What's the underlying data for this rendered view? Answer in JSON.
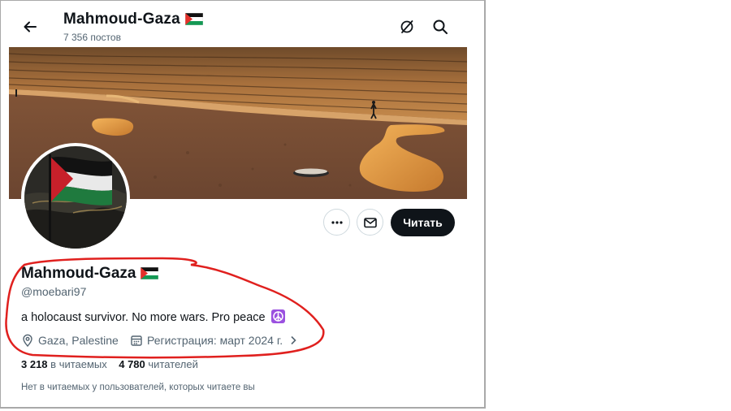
{
  "header": {
    "title": "Mahmoud-Gaza",
    "posts_count": "7 356 постов"
  },
  "profile": {
    "name": "Mahmoud-Gaza",
    "handle": "@moebari97",
    "bio": "a holocaust survivor. No more wars. Pro peace",
    "location": "Gaza, Palestine",
    "joined": "Регистрация: март 2024 г.",
    "following_count": "3 218",
    "following_label": "в читаемых",
    "followers_count": "4 780",
    "followers_label": "читателей",
    "mutuals_note": "Нет в читаемых у пользователей, которых читаете вы"
  },
  "actions": {
    "follow_label": "Читать"
  },
  "icons": [
    "back-arrow-icon",
    "flag-emoji-icon",
    "grok-icon",
    "search-icon",
    "more-icon",
    "mail-icon",
    "peace-icon",
    "location-icon",
    "calendar-icon",
    "chevron-right-icon"
  ],
  "colors": {
    "annotation": "#e0201e",
    "follow_button": "#0f1419",
    "secondary_text": "#536471"
  }
}
